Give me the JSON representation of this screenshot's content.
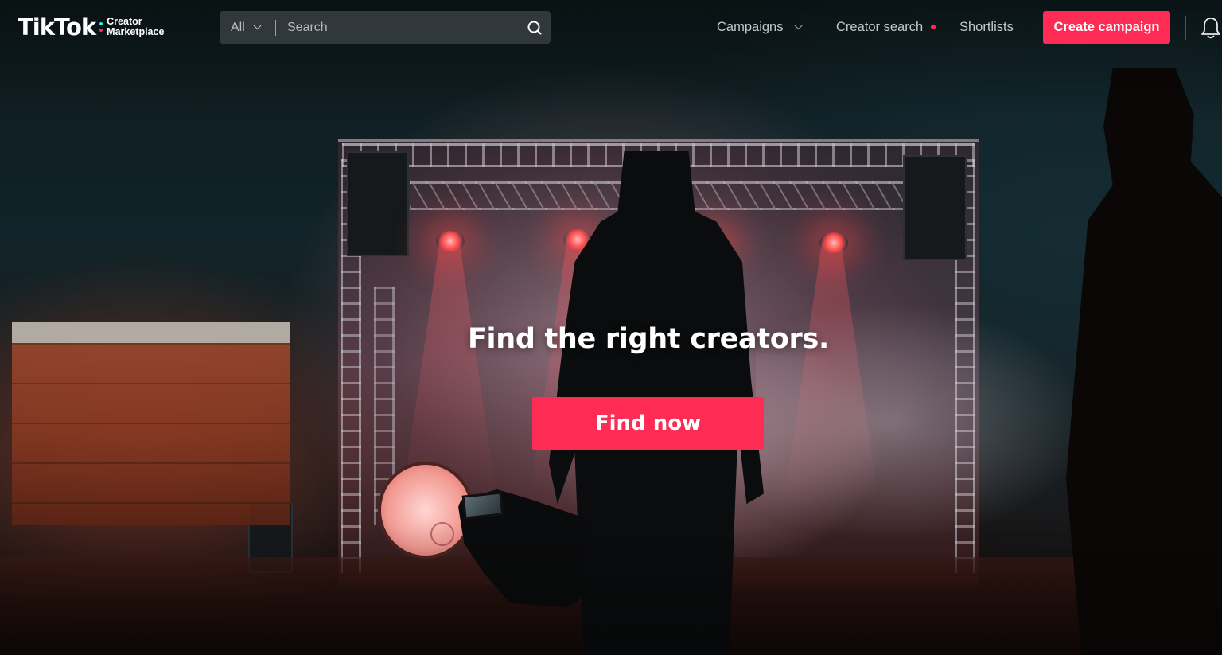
{
  "brand": {
    "logo_text": "TikTok",
    "logo_sub_line1": "Creator",
    "logo_sub_line2": "Marketplace",
    "dot_colors": [
      "#25f4ee",
      "#fe2c55"
    ]
  },
  "search": {
    "scope_label": "All",
    "placeholder": "Search",
    "icon": "search-icon"
  },
  "nav": {
    "campaigns_label": "Campaigns",
    "creator_search_label": "Creator search",
    "shortlists_label": "Shortlists",
    "create_campaign_label": "Create campaign",
    "notification_icon": "bell-icon"
  },
  "hero": {
    "headline": "Find the right creators.",
    "cta_label": "Find now"
  },
  "colors": {
    "accent": "#fe2c55",
    "nav_text": "#c4c8ca",
    "search_bg": "#3c4246"
  }
}
